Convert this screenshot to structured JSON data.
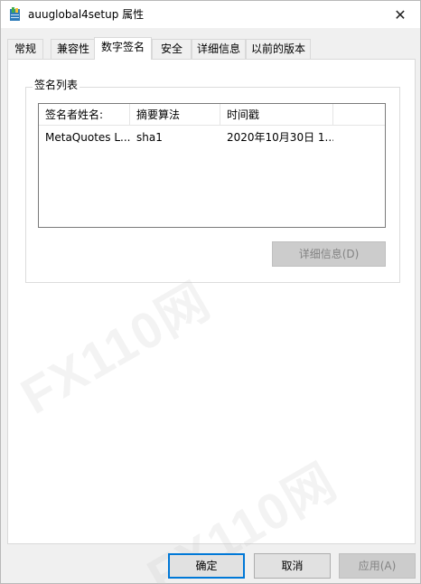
{
  "window": {
    "title": "auuglobal4setup 属性",
    "close_glyph": "✕"
  },
  "tabs": [
    {
      "label": "常规"
    },
    {
      "label": "兼容性"
    },
    {
      "label": "数字签名",
      "active": true
    },
    {
      "label": "安全"
    },
    {
      "label": "详细信息"
    },
    {
      "label": "以前的版本"
    }
  ],
  "signature_list": {
    "legend": "签名列表",
    "columns": [
      "签名者姓名:",
      "摘要算法",
      "时间戳"
    ],
    "rows": [
      [
        "MetaQuotes L...",
        "sha1",
        "2020年10月30日 1..."
      ]
    ]
  },
  "details_button": "详细信息(D)",
  "footer": {
    "ok": "确定",
    "cancel": "取消",
    "apply": "应用(A)"
  },
  "watermark_text": "FX110网",
  "colors": {
    "accent": "#0078d7",
    "disabled_text": "#838383"
  }
}
